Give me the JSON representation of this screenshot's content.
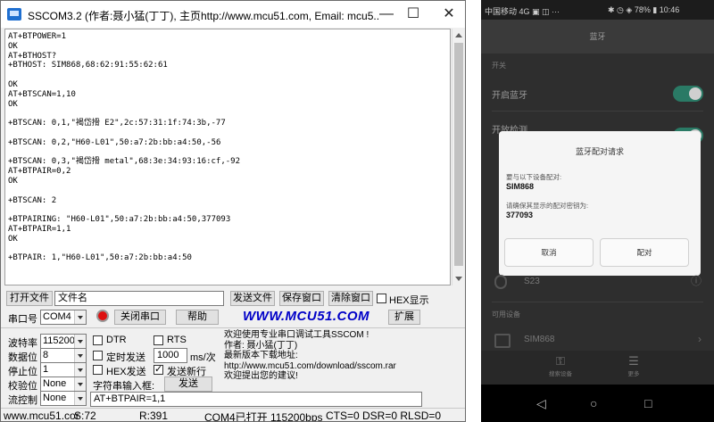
{
  "window": {
    "title": "SSCOM3.2 (作者:聂小猛(丁丁), 主页http://www.mcu51.com,  Email: mcu5...",
    "minimize": "—",
    "maximize": "☐",
    "close": "✕"
  },
  "terminal": {
    "text": "AT+BTPOWER=1\nOK\nAT+BTHOST?\n+BTHOST: SIM868,68:62:91:55:62:61\n\nOK\nAT+BTSCAN=1,10\nOK\n\n+BTSCAN: 0,1,\"褐岱搰 E2\",2c:57:31:1f:74:3b,-77\n\n+BTSCAN: 0,2,\"H60-L01\",50:a7:2b:bb:a4:50,-56\n\n+BTSCAN: 0,3,\"褐岱搰 metal\",68:3e:34:93:16:cf,-92\nAT+BTPAIR=0,2\nOK\n\n+BTSCAN: 2\n\n+BTPAIRING: \"H60-L01\",50:a7:2b:bb:a4:50,377093\nAT+BTPAIR=1,1\nOK\n\n+BTPAIR: 1,\"H60-L01\",50:a7:2b:bb:a4:50"
  },
  "toolbar": {
    "open_file": "打开文件",
    "filename": "文件名",
    "send_file": "发送文件",
    "save_window": "保存窗口",
    "clear_window": "清除窗口",
    "hex_display": "HEX显示",
    "port_label": "串口号",
    "port_value": "COM4",
    "close_port": "关闭串口",
    "help": "帮助",
    "brand": "WWW.MCU51.COM",
    "expand": "扩展"
  },
  "settings": {
    "baud_label": "波特率",
    "baud_value": "115200",
    "databits_label": "数据位",
    "databits_value": "8",
    "stopbits_label": "停止位",
    "stopbits_value": "1",
    "parity_label": "校验位",
    "parity_value": "None",
    "flow_label": "流控制",
    "flow_value": "None",
    "dtr": "DTR",
    "rts": "RTS",
    "timed_send": "定时发送",
    "interval_value": "1000",
    "interval_unit": "ms/次",
    "hex_send": "HEX发送",
    "send_newline": "发送新行",
    "input_label": "字符串输入框:",
    "send": "发送",
    "input_value": "AT+BTPAIR=1,1"
  },
  "info_text": "欢迎使用专业串口调试工具SSCOM !\n作者: 聂小猛(丁丁)\n最新版本下载地址:\nhttp://www.mcu51.com/download/sscom.rar\n欢迎提出您的建议!",
  "status": {
    "site": "www.mcu51.cor",
    "sent": "S:72",
    "received": "R:391",
    "port_state": "COM4已打开  115200bps",
    "lines": "CTS=0 DSR=0 RLSD=0"
  },
  "phone": {
    "status_left": "中国移动 4G ▣ ◫ ···",
    "status_right": "✱ ◷ ◈ 78% ▮ 10:46",
    "page_title": "蓝牙",
    "section_switch": "开关",
    "bt_toggle_label": "开启蓝牙",
    "bt_visible_label": "开放检测",
    "dialog": {
      "title": "蓝牙配对请求",
      "line1": "要与以下设备配对:",
      "device": "SIM868",
      "line2": "请确保其显示的配对密钥为:",
      "passkey": "377093",
      "cancel": "取消",
      "pair": "配对"
    },
    "paired_device": "S23",
    "section_available": "可用设备",
    "available_device": "SIM868",
    "tab_scan": "搜索设备",
    "tab_more": "更多",
    "accent": "#2a7a65"
  }
}
